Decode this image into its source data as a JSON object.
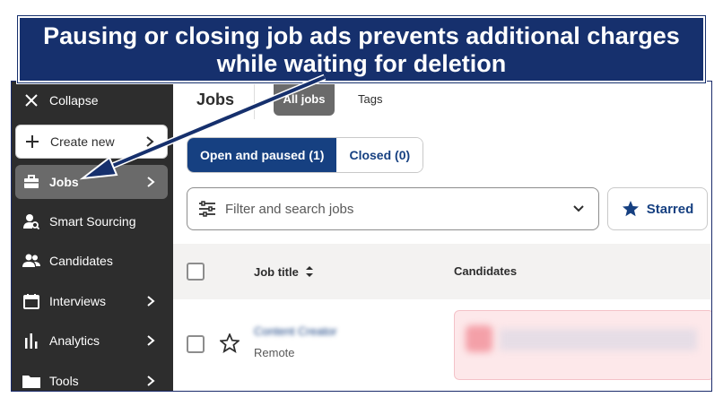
{
  "banner": {
    "line1": "Pausing or closing job ads prevents additional charges",
    "line2": "while waiting for deletion"
  },
  "sidebar": {
    "items": [
      {
        "label": "Collapse",
        "icon": "close-icon"
      },
      {
        "label": "Create new",
        "icon": "plus-icon"
      },
      {
        "label": "Jobs",
        "icon": "briefcase-icon"
      },
      {
        "label": "Smart Sourcing",
        "icon": "person-search-icon"
      },
      {
        "label": "Candidates",
        "icon": "people-icon"
      },
      {
        "label": "Interviews",
        "icon": "calendar-icon"
      },
      {
        "label": "Analytics",
        "icon": "bar-chart-icon"
      },
      {
        "label": "Tools",
        "icon": "folder-icon"
      }
    ]
  },
  "header": {
    "title": "Jobs",
    "tab_all": "All jobs",
    "tab_tags": "Tags"
  },
  "segments": {
    "open": "Open and paused (1)",
    "closed": "Closed (0)"
  },
  "filter": {
    "placeholder": "Filter and search jobs",
    "starred": "Starred"
  },
  "table": {
    "col_job": "Job title",
    "col_candidates": "Candidates",
    "rows": [
      {
        "title": "Content Creator",
        "location": "Remote"
      }
    ]
  },
  "colors": {
    "accent": "#164081",
    "sidebar_bg": "#2d2d2d",
    "banner_bg": "#16306d"
  }
}
